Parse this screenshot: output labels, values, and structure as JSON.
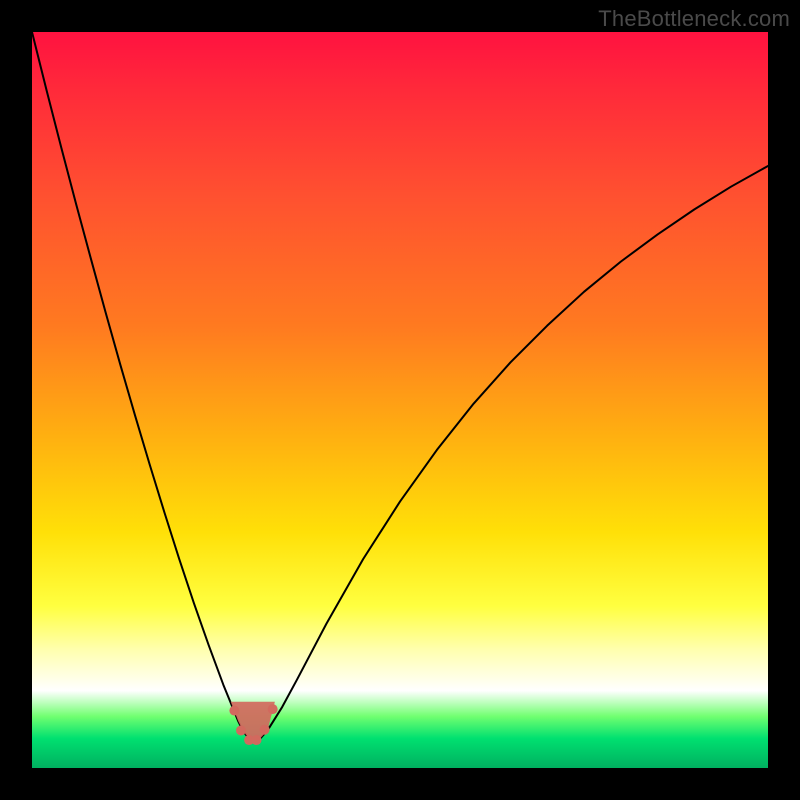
{
  "watermark": "TheBottleneck.com",
  "chart_data": {
    "type": "line",
    "title": "",
    "xlabel": "",
    "ylabel": "",
    "xlim": [
      0,
      1
    ],
    "ylim": [
      0,
      1
    ],
    "x": [
      0.0,
      0.02,
      0.04,
      0.06,
      0.08,
      0.1,
      0.12,
      0.14,
      0.16,
      0.18,
      0.2,
      0.22,
      0.24,
      0.26,
      0.28,
      0.285,
      0.29,
      0.295,
      0.3,
      0.305,
      0.31,
      0.32,
      0.34,
      0.36,
      0.4,
      0.45,
      0.5,
      0.55,
      0.6,
      0.65,
      0.7,
      0.75,
      0.8,
      0.85,
      0.9,
      0.95,
      1.0
    ],
    "values": [
      1.0,
      0.92,
      0.842,
      0.766,
      0.692,
      0.619,
      0.548,
      0.479,
      0.412,
      0.347,
      0.284,
      0.224,
      0.167,
      0.113,
      0.064,
      0.054,
      0.046,
      0.04,
      0.037,
      0.037,
      0.04,
      0.051,
      0.083,
      0.12,
      0.196,
      0.284,
      0.362,
      0.432,
      0.495,
      0.551,
      0.601,
      0.647,
      0.688,
      0.725,
      0.759,
      0.79,
      0.818
    ],
    "notch_x_range": [
      0.27,
      0.33
    ],
    "notch_y_cap": 0.09,
    "notch_points_x": [
      0.275,
      0.284,
      0.295,
      0.305,
      0.316,
      0.327
    ],
    "notch_points_y": [
      0.078,
      0.051,
      0.038,
      0.038,
      0.052,
      0.08
    ],
    "colors": {
      "curve": "#000000",
      "notch": "#d2695e"
    }
  }
}
